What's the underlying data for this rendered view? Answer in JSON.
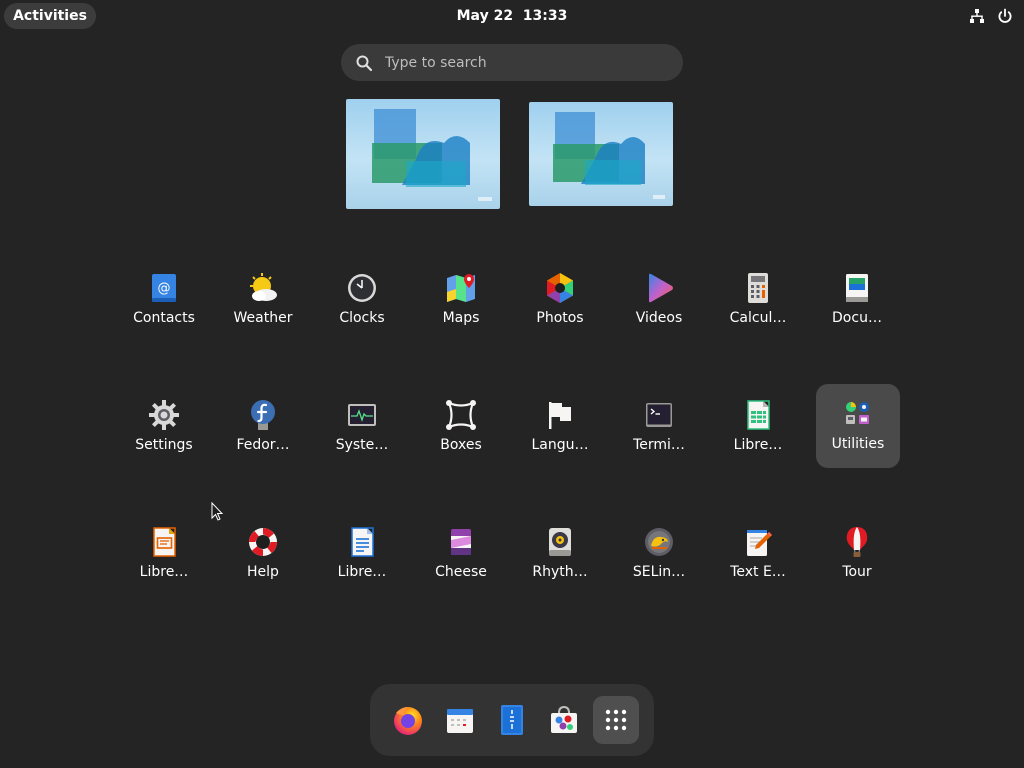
{
  "topbar": {
    "activities_label": "Activities",
    "clock": "May 22  13:33",
    "tray_icons": [
      "network-icon",
      "power-icon"
    ]
  },
  "search": {
    "placeholder": "Type to search"
  },
  "workspaces": [
    "workspace-1",
    "workspace-2"
  ],
  "apps": [
    {
      "label": "Contacts",
      "icon": "contacts-icon"
    },
    {
      "label": "Weather",
      "icon": "weather-icon"
    },
    {
      "label": "Clocks",
      "icon": "clocks-icon"
    },
    {
      "label": "Maps",
      "icon": "maps-icon"
    },
    {
      "label": "Photos",
      "icon": "photos-icon"
    },
    {
      "label": "Videos",
      "icon": "videos-icon"
    },
    {
      "label": "Calcul…",
      "icon": "calculator-icon"
    },
    {
      "label": "Docu…",
      "icon": "document-viewer-icon"
    },
    {
      "label": "Settings",
      "icon": "settings-icon"
    },
    {
      "label": "Fedor…",
      "icon": "fedora-icon"
    },
    {
      "label": "Syste…",
      "icon": "system-monitor-icon"
    },
    {
      "label": "Boxes",
      "icon": "boxes-icon"
    },
    {
      "label": "Langu…",
      "icon": "language-icon"
    },
    {
      "label": "Termi…",
      "icon": "terminal-icon"
    },
    {
      "label": "Libre…",
      "icon": "libreoffice-calc-icon"
    },
    {
      "label": "Utilities",
      "icon": "utilities-folder-icon"
    },
    {
      "label": "Libre…",
      "icon": "libreoffice-impress-icon"
    },
    {
      "label": "Help",
      "icon": "help-icon"
    },
    {
      "label": "Libre…",
      "icon": "libreoffice-writer-icon"
    },
    {
      "label": "Cheese",
      "icon": "cheese-icon"
    },
    {
      "label": "Rhyth…",
      "icon": "rhythmbox-icon"
    },
    {
      "label": "SELin…",
      "icon": "selinux-troubleshooter-icon"
    },
    {
      "label": "Text E…",
      "icon": "text-editor-icon"
    },
    {
      "label": "Tour",
      "icon": "tour-icon"
    }
  ],
  "dash": [
    "firefox-icon",
    "calendar-icon",
    "files-icon",
    "software-icon",
    "show-apps-icon"
  ],
  "colors": {
    "background": "#242424",
    "selected_tile": "#4a4a4a",
    "dash": "#333333"
  }
}
